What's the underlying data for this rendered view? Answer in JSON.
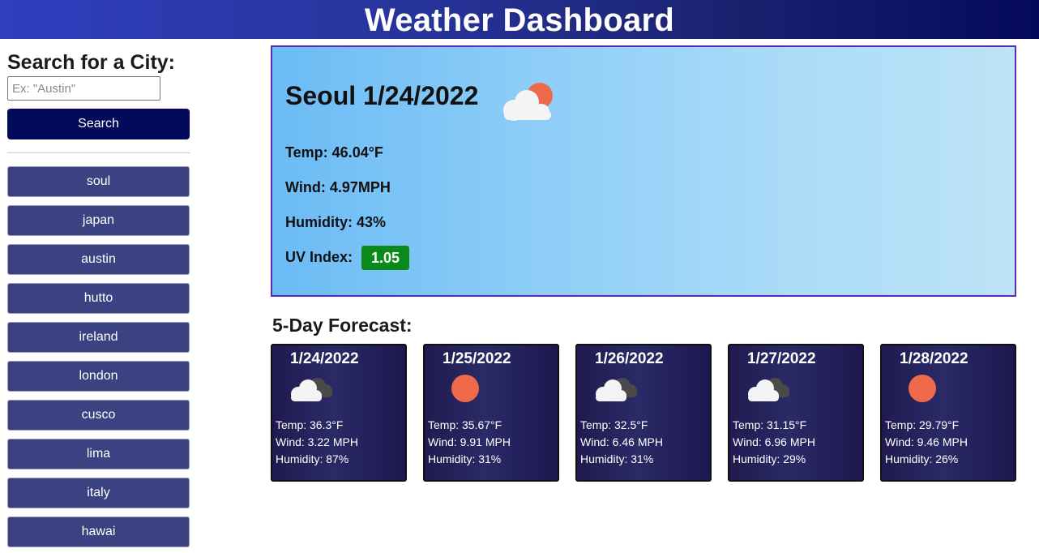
{
  "header": {
    "title": "Weather Dashboard"
  },
  "sidebar": {
    "heading": "Search for a City:",
    "search_placeholder": "Ex: \"Austin\"",
    "search_value": "",
    "search_button": "Search",
    "history": [
      "soul",
      "japan",
      "austin",
      "hutto",
      "ireland",
      "london",
      "cusco",
      "lima",
      "italy",
      "hawai"
    ]
  },
  "current": {
    "title": "Seoul 1/24/2022",
    "icon": "partly-cloudy-icon",
    "temp": "Temp: 46.04°F",
    "wind": "Wind: 4.97MPH",
    "humidity": "Humidity: 43%",
    "uv_label": "UV Index:",
    "uv_value": "1.05",
    "uv_color": "#0a8a1a"
  },
  "forecast": {
    "heading": "5-Day Forecast:",
    "days": [
      {
        "date": "1/24/2022",
        "icon": "broken-clouds-icon",
        "temp": "Temp: 36.3°F",
        "wind": "Wind: 3.22 MPH",
        "humidity": "Humidity: 87%"
      },
      {
        "date": "1/25/2022",
        "icon": "sun-icon",
        "temp": "Temp: 35.67°F",
        "wind": "Wind: 9.91 MPH",
        "humidity": "Humidity: 31%"
      },
      {
        "date": "1/26/2022",
        "icon": "broken-clouds-icon",
        "temp": "Temp: 32.5°F",
        "wind": "Wind: 6.46 MPH",
        "humidity": "Humidity: 31%"
      },
      {
        "date": "1/27/2022",
        "icon": "broken-clouds-icon",
        "temp": "Temp: 31.15°F",
        "wind": "Wind: 6.96 MPH",
        "humidity": "Humidity: 29%"
      },
      {
        "date": "1/28/2022",
        "icon": "sun-icon",
        "temp": "Temp: 29.79°F",
        "wind": "Wind: 9.46 MPH",
        "humidity": "Humidity: 26%"
      }
    ]
  },
  "colors": {
    "header_gradient_start": "#2f3fbf",
    "header_gradient_end": "#04095e",
    "search_button": "#040a5a",
    "history_button": "#3b4282",
    "current_border": "#5a2cb5",
    "sun": "#ee6a4b"
  }
}
